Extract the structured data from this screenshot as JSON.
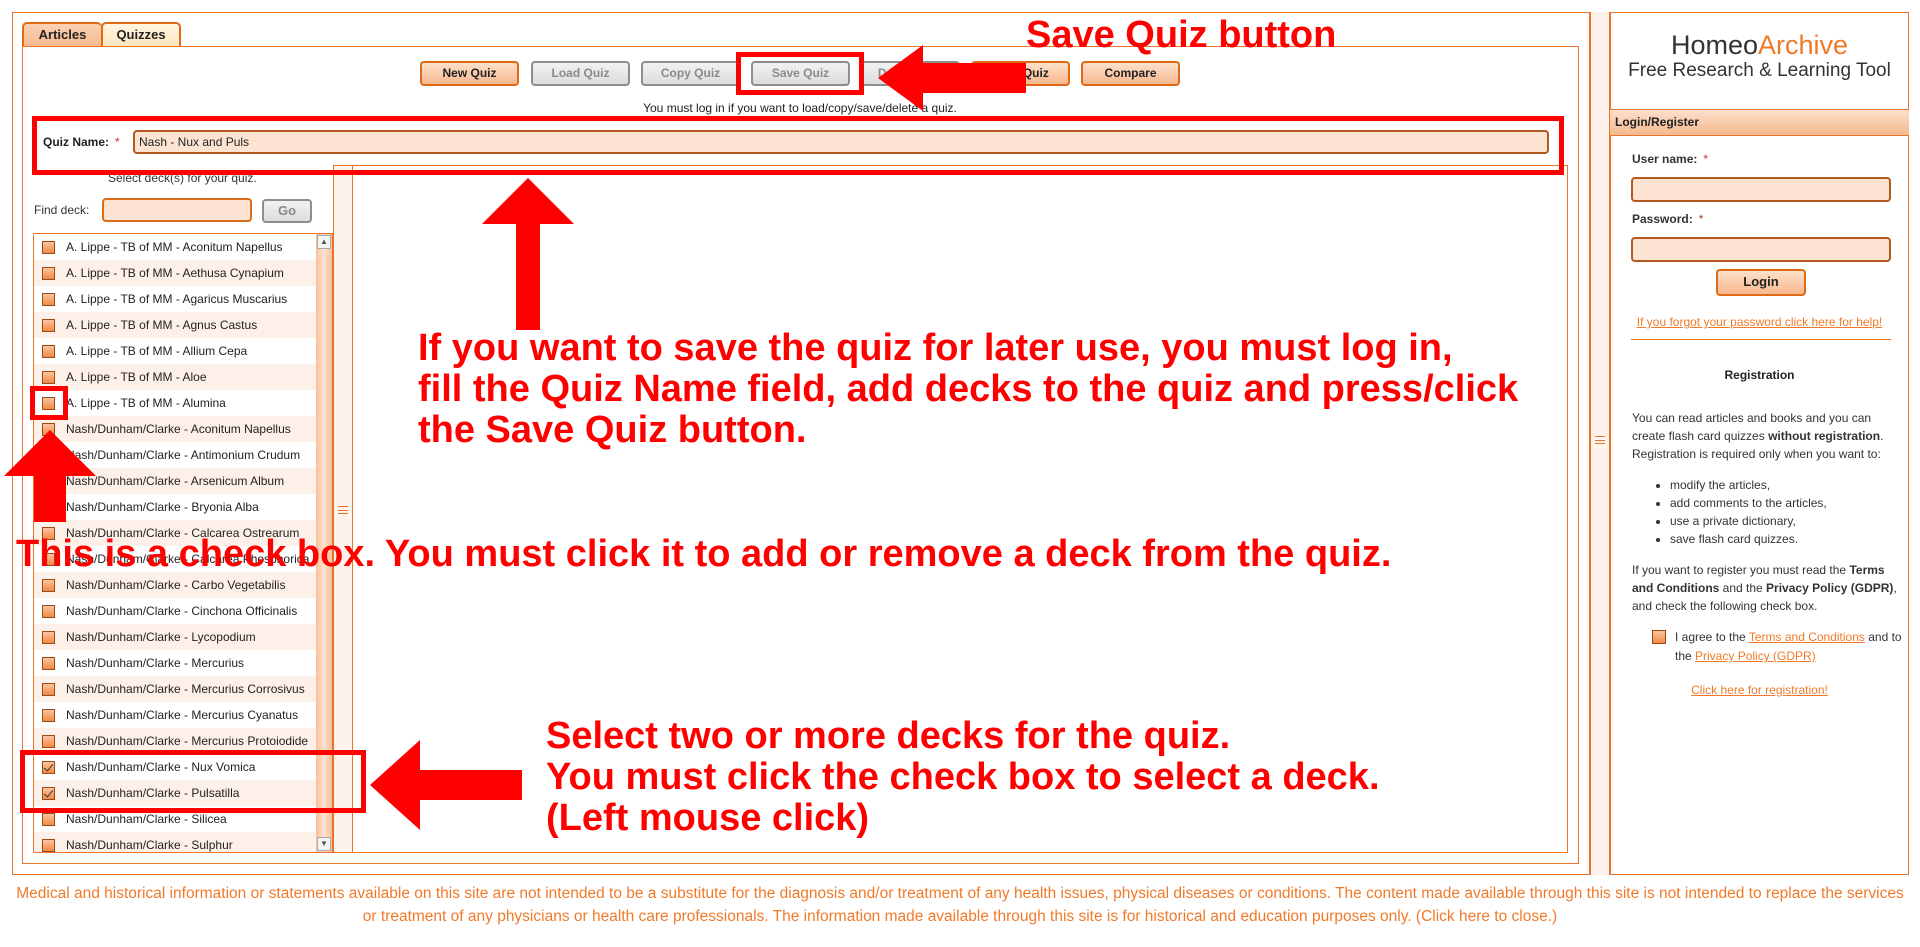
{
  "tabs": [
    {
      "label": "Articles",
      "active": false
    },
    {
      "label": "Quizzes",
      "active": true
    }
  ],
  "toolbar": {
    "new_quiz": "New Quiz",
    "load_quiz": "Load Quiz",
    "copy_quiz": "Copy Quiz",
    "save_quiz": "Save Quiz",
    "delete_quiz": "Delete Quiz",
    "start_quiz": "Start Quiz",
    "compare": "Compare",
    "note": "You must log in if you want to load/copy/save/delete a quiz."
  },
  "quiz_form": {
    "name_label": "Quiz Name:",
    "required_mark": "*",
    "name_value": "Nash - Nux and Puls",
    "select_hint": "Select deck(s) for your quiz.",
    "find_label": "Find deck:",
    "find_value": "",
    "go_label": "Go"
  },
  "decks": [
    {
      "label": "A. Lippe - TB of MM - Aconitum Napellus",
      "checked": false
    },
    {
      "label": "A. Lippe - TB of MM - Aethusa Cynapium",
      "checked": false
    },
    {
      "label": "A. Lippe - TB of MM - Agaricus Muscarius",
      "checked": false
    },
    {
      "label": "A. Lippe - TB of MM - Agnus Castus",
      "checked": false
    },
    {
      "label": "A. Lippe - TB of MM - Allium Cepa",
      "checked": false
    },
    {
      "label": "A. Lippe - TB of MM - Aloe",
      "checked": false
    },
    {
      "label": "A. Lippe - TB of MM - Alumina",
      "checked": false
    },
    {
      "label": "Nash/Dunham/Clarke - Aconitum Napellus",
      "checked": false
    },
    {
      "label": "Nash/Dunham/Clarke - Antimonium Crudum",
      "checked": false
    },
    {
      "label": "Nash/Dunham/Clarke - Arsenicum Album",
      "checked": false
    },
    {
      "label": "Nash/Dunham/Clarke - Bryonia Alba",
      "checked": false
    },
    {
      "label": "Nash/Dunham/Clarke - Calcarea Ostrearum",
      "checked": false
    },
    {
      "label": "Nash/Dunham/Clarke - Calcarea Phosphorica",
      "checked": false
    },
    {
      "label": "Nash/Dunham/Clarke - Carbo Vegetabilis",
      "checked": false
    },
    {
      "label": "Nash/Dunham/Clarke - Cinchona Officinalis",
      "checked": false
    },
    {
      "label": "Nash/Dunham/Clarke - Lycopodium",
      "checked": false
    },
    {
      "label": "Nash/Dunham/Clarke - Mercurius",
      "checked": false
    },
    {
      "label": "Nash/Dunham/Clarke - Mercurius Corrosivus",
      "checked": false
    },
    {
      "label": "Nash/Dunham/Clarke - Mercurius Cyanatus",
      "checked": false
    },
    {
      "label": "Nash/Dunham/Clarke - Mercurius Protoiodide",
      "checked": false
    },
    {
      "label": "Nash/Dunham/Clarke - Nux Vomica",
      "checked": true
    },
    {
      "label": "Nash/Dunham/Clarke - Pulsatilla",
      "checked": true
    },
    {
      "label": "Nash/Dunham/Clarke - Silicea",
      "checked": false
    },
    {
      "label": "Nash/Dunham/Clarke - Sulphur",
      "checked": false
    }
  ],
  "sidebar": {
    "brand_part1": "Homeo",
    "brand_part2": "Archive",
    "brand_sub": "Free Research & Learning Tool",
    "login_header": "Login/Register",
    "username_label": "User name:",
    "password_label": "Password:",
    "required_mark": "*",
    "username_value": "",
    "password_value": "",
    "login_button": "Login",
    "forgot_link": "If you forgot your password click here for help!",
    "registration_title": "Registration",
    "reg_text_1": "You can read articles and books and you can create flash card quizzes ",
    "reg_text_bold": "without registration",
    "reg_text_2": ". Registration is required only when you want to:",
    "reg_list": [
      "modify the articles,",
      "add comments to the articles,",
      "use a private dictionary,",
      "save flash card quizzes."
    ],
    "terms_1": "If you want to register you must read the ",
    "terms_b1": "Terms and Conditions",
    "terms_2": " and the ",
    "terms_b2": "Privacy Policy (GDPR)",
    "terms_3": ", and check the following check box.",
    "agree_1": "I agree to the ",
    "agree_link1": "Terms and Conditions",
    "agree_2": " and to the ",
    "agree_link2": "Privacy Policy (GDPR)",
    "register_link": "Click here for registration!"
  },
  "disclaimer": "Medical and historical information or statements available on this site are not intended to be a substitute for the diagnosis and/or treatment of any health issues, physical diseases or conditions. The content made available through this site is not intended to replace the services or treatment of any physicians or health care professionals. The information made available through this site is for historical and education purposes only. (Click here to close.)",
  "annotations": {
    "save_button_note": "Save Quiz button",
    "save_instructions": [
      "If you want to save the quiz for later use, you must log in,",
      "fill the Quiz Name field, add decks to the quiz and press/click",
      "the Save Quiz button."
    ],
    "checkbox_note": "This is a check box. You must click it to add or remove a deck from the quiz.",
    "select_instructions": [
      "Select two or more decks for the quiz.",
      "You must click the check box to select a deck.",
      "(Left mouse click)"
    ],
    "color": "#ff0000"
  },
  "colors": {
    "accent": "#f07a2a",
    "border": "#e9742a",
    "input_bg": "#fde3d2"
  }
}
